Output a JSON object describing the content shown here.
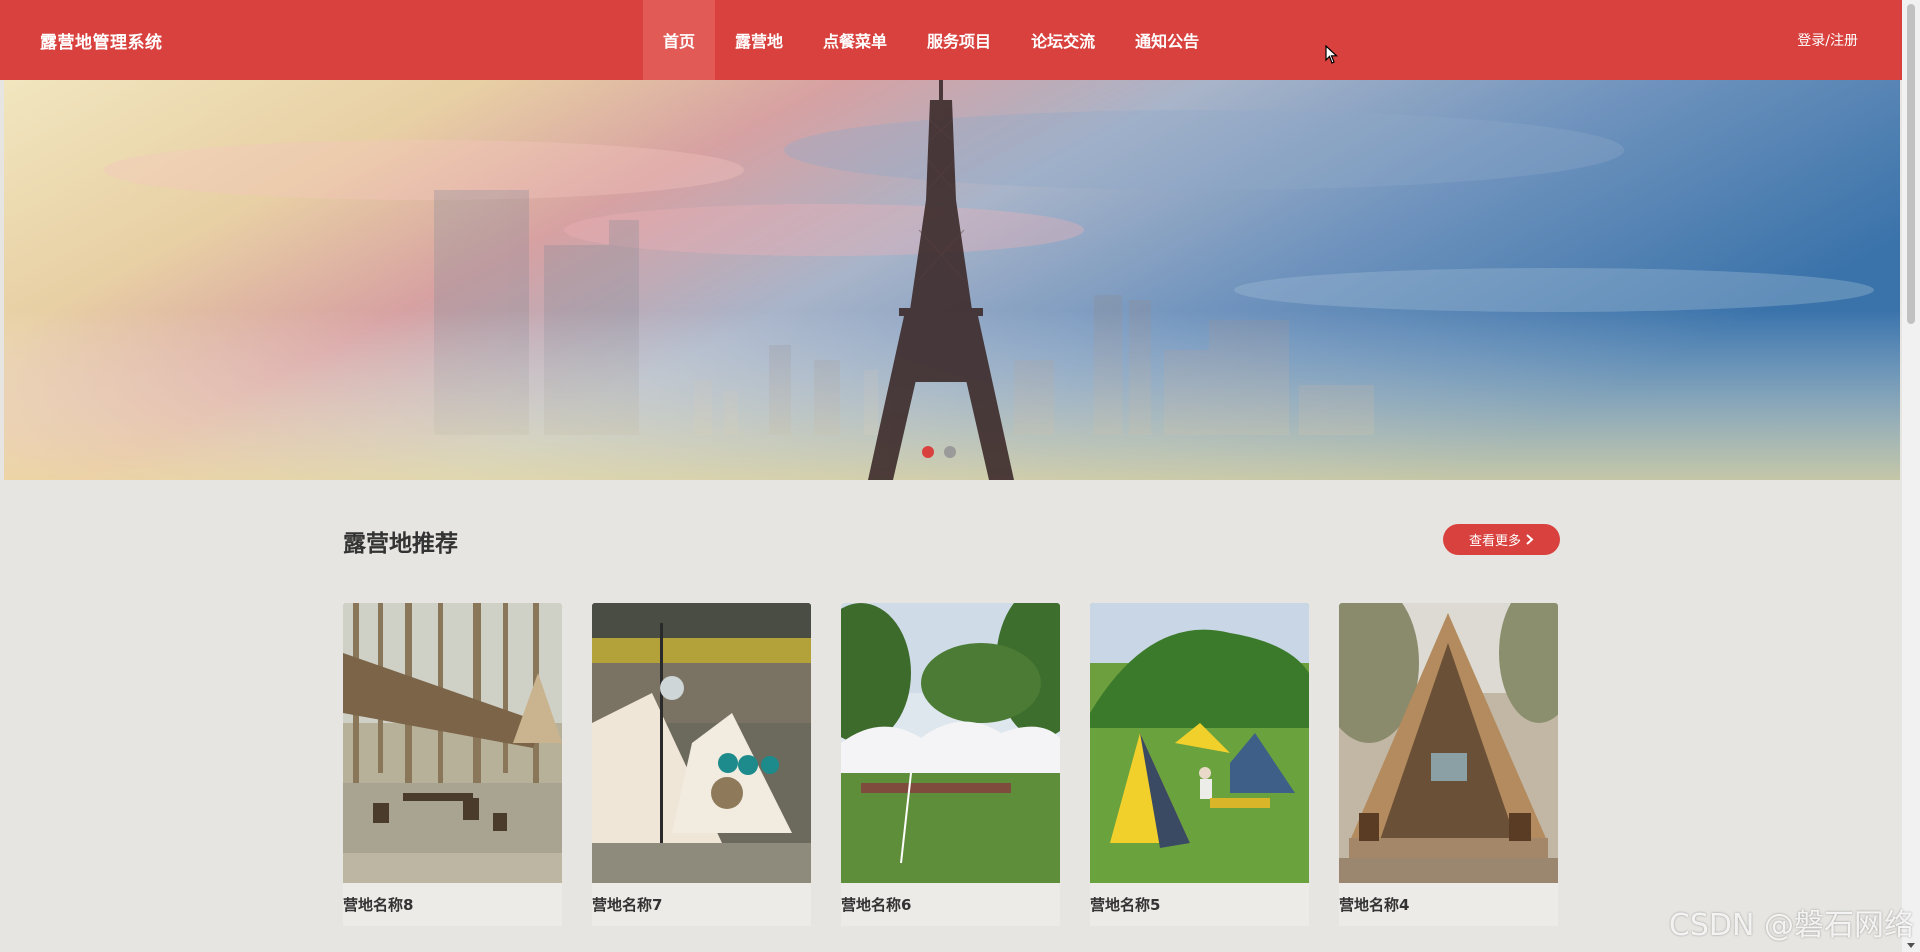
{
  "header": {
    "brand": "露营地管理系统",
    "nav": [
      {
        "label": "首页",
        "active": true
      },
      {
        "label": "露营地",
        "active": false
      },
      {
        "label": "点餐菜单",
        "active": false
      },
      {
        "label": "服务项目",
        "active": false
      },
      {
        "label": "论坛交流",
        "active": false
      },
      {
        "label": "通知公告",
        "active": false
      }
    ],
    "login_label": "登录/注册"
  },
  "banner": {
    "slides": 2,
    "active_slide": 1
  },
  "section": {
    "title": "露营地推荐",
    "more_label": "查看更多"
  },
  "cards": [
    {
      "name": "营地名称8"
    },
    {
      "name": "营地名称7"
    },
    {
      "name": "营地名称6"
    },
    {
      "name": "营地名称5"
    },
    {
      "name": "营地名称4"
    }
  ],
  "watermark": "CSDN @磐石网络",
  "colors": {
    "accent": "#d8413e",
    "page_background": "#e6e5e1"
  }
}
